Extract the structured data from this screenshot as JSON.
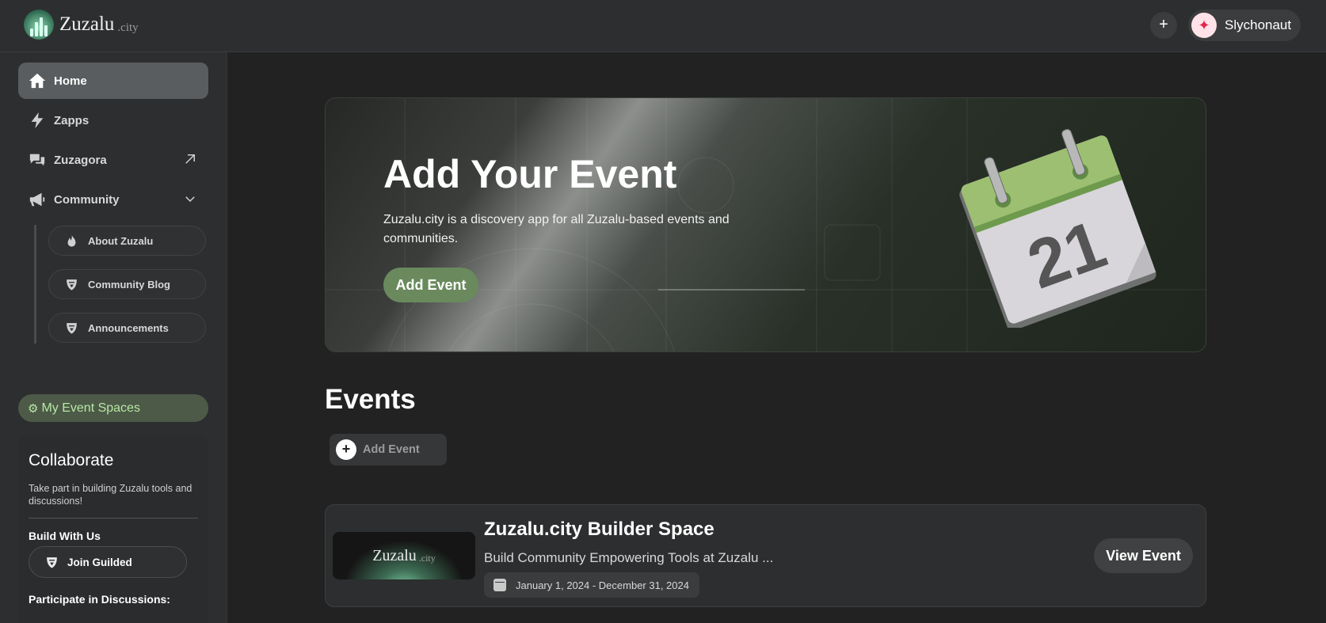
{
  "header": {
    "logo_text": "Zuzalu",
    "logo_suffix": ".city",
    "plus_label": "+",
    "user_name": "Slychonaut"
  },
  "sidebar": {
    "nav": [
      {
        "label": "Home",
        "icon": "home-icon",
        "active": true
      },
      {
        "label": "Zapps",
        "icon": "lightning-icon"
      },
      {
        "label": "Zuzagora",
        "icon": "chat-icon",
        "trailing_icon": "external-arrow-icon"
      },
      {
        "label": "Community",
        "icon": "megaphone-icon",
        "trailing_icon": "chevron-down-icon"
      }
    ],
    "community_items": [
      {
        "label": "About Zuzalu",
        "icon": "fire-icon"
      },
      {
        "label": "Community Blog",
        "icon": "guilded-icon"
      },
      {
        "label": "Announcements",
        "icon": "guilded-icon"
      }
    ],
    "my_event_spaces": "My Event Spaces",
    "collaborate": {
      "title": "Collaborate",
      "description": "Take part in building Zuzalu tools and discussions!",
      "build_heading": "Build With Us",
      "join_button": "Join Guilded",
      "participate_heading": "Participate in Discussions:"
    }
  },
  "banner": {
    "title": "Add Your Event",
    "description": "Zuzalu.city is a discovery app for all Zuzalu-based events and communities.",
    "button": "Add Event",
    "calendar_day": "21"
  },
  "events": {
    "heading": "Events",
    "add_button": "Add Event",
    "items": [
      {
        "thumb_text": "Zuzalu",
        "thumb_suffix": ".city",
        "title": "Zuzalu.city Builder Space",
        "description": "Build Community Empowering Tools at Zuzalu ...",
        "date": "January 1, 2024 - December 31, 2024",
        "view_button": "View Event"
      }
    ]
  },
  "colors": {
    "accent_green": "#6a8a5e",
    "my_spaces_text": "#b6e8a6",
    "avatar_red": "#e0264b"
  }
}
